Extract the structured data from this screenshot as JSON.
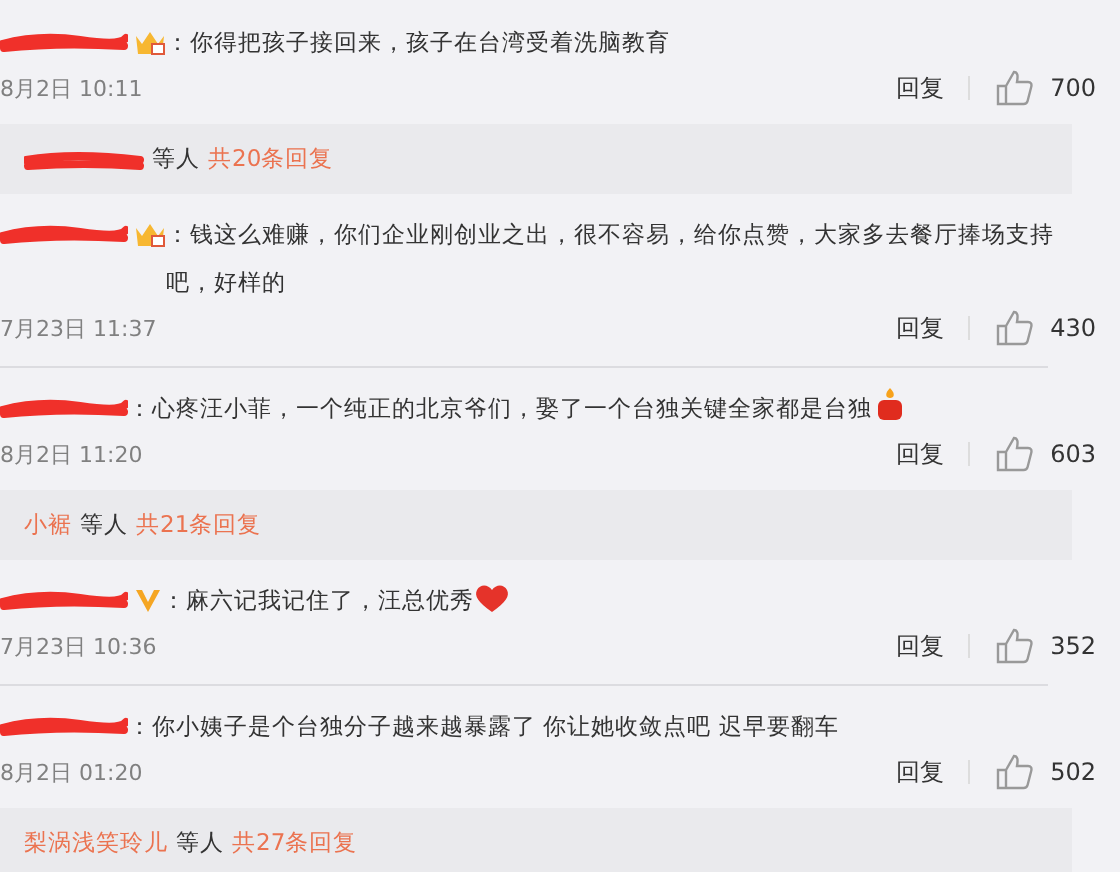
{
  "comments": [
    {
      "redacted": true,
      "badge": {
        "kind": "crown"
      },
      "text": "：你得把孩子接回来，孩子在台湾受着洗脑教育",
      "date": "8月2日 10:11",
      "reply_label": "回复",
      "likes": "700",
      "replies": {
        "redacted": true,
        "others": "等人",
        "count": "共20条回复"
      }
    },
    {
      "redacted": true,
      "badge": {
        "kind": "crown"
      },
      "text": "：钱这么难赚，你们企业刚创业之出，很不容易，给你点赞，大家多去餐厅捧场支持吧，好样的",
      "date": "7月23日 11:37",
      "reply_label": "回复",
      "likes": "430"
    },
    {
      "redacted": true,
      "text": "：心疼汪小菲，一个纯正的北京爷们，娶了一个台独关键全家都是台独",
      "emoji": {
        "kind": "candle"
      },
      "date": "8月2日 11:20",
      "reply_label": "回复",
      "likes": "603",
      "replies": {
        "user": "小裾",
        "others": "等人",
        "count": "共21条回复"
      }
    },
    {
      "redacted": true,
      "badge": {
        "kind": "v"
      },
      "text": "：麻六记我记住了，汪总优秀",
      "emoji": {
        "kind": "heart"
      },
      "date": "7月23日 10:36",
      "reply_label": "回复",
      "likes": "352"
    },
    {
      "redacted": true,
      "text": "：你小姨子是个台独分子越来越暴露了 你让她收敛点吧 迟早要翻车",
      "date": "8月2日 01:20",
      "reply_label": "回复",
      "likes": "502",
      "replies": {
        "user": "梨涡浅笑玲儿",
        "others": "等人",
        "count": "共27条回复"
      }
    }
  ]
}
